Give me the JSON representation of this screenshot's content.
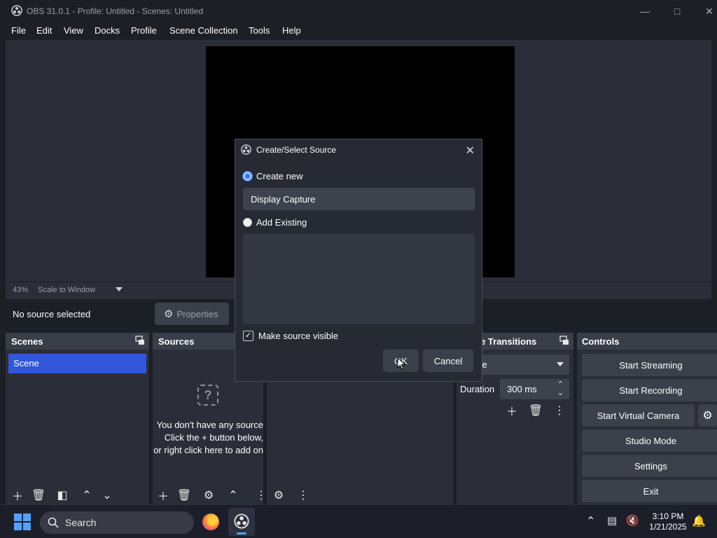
{
  "window": {
    "title": "OBS 31.0.1 - Profile: Untitled - Scenes: Untitled"
  },
  "menubar": [
    "File",
    "Edit",
    "View",
    "Docks",
    "Profile",
    "Scene Collection",
    "Tools",
    "Help"
  ],
  "preview": {
    "zoom": "43%",
    "scale_mode": "Scale to Window"
  },
  "source_bar": {
    "no_source": "No source selected",
    "properties": "Properties"
  },
  "docks": {
    "scenes": {
      "title": "Scenes",
      "items": [
        "Scene"
      ]
    },
    "sources": {
      "title": "Sources",
      "empty_lines": [
        "You don't have any source",
        "Click the + button below,",
        "or right click here to add on"
      ]
    },
    "transitions": {
      "title": "Scene Transitions",
      "selected": "Fade",
      "duration_label": "Duration",
      "duration_value": "300 ms"
    },
    "controls": {
      "title": "Controls",
      "buttons": [
        "Start Streaming",
        "Start Recording",
        "Start Virtual Camera",
        "Studio Mode",
        "Settings",
        "Exit"
      ]
    }
  },
  "dialog": {
    "title": "Create/Select Source",
    "create_new_label": "Create new",
    "create_new_value": "Display Capture",
    "add_existing_label": "Add Existing",
    "visible_label": "Make source visible",
    "ok": "OK",
    "cancel": "Cancel"
  },
  "taskbar": {
    "search": "Search",
    "time": "3:10 PM",
    "date": "1/21/2025"
  },
  "colors": {
    "accent": "#2f57d8",
    "bg": "#1d1f26",
    "panel": "#2b2e38"
  },
  "icons": [
    "obs-icon",
    "minimize-icon",
    "maximize-icon",
    "close-icon",
    "properties-gear-icon",
    "plus-icon",
    "trash-icon",
    "filter-icon",
    "arrow-up-icon",
    "arrow-down-icon",
    "settings-icon",
    "more-icon",
    "windows-icon",
    "search-icon",
    "firefox-icon",
    "chevron-up-icon",
    "network-icon",
    "volume-icon",
    "bell-icon"
  ]
}
